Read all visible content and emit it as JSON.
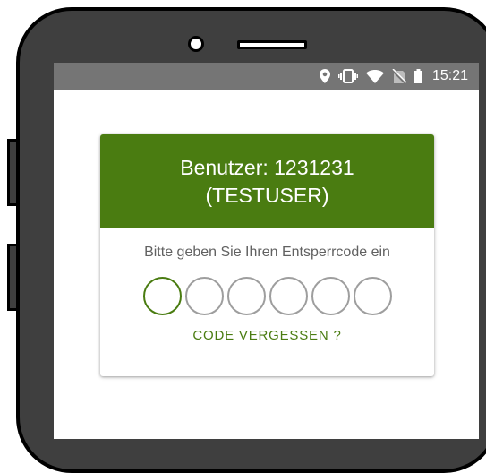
{
  "status_bar": {
    "time": "15:21",
    "icons": [
      "location-icon",
      "vibrate-icon",
      "wifi-icon",
      "no-sim-icon",
      "battery-icon"
    ]
  },
  "login_card": {
    "user_line": "Benutzer: 1231231",
    "user_name": "(TESTUSER)",
    "prompt": "Bitte geben Sie Ihren Entsperrcode ein",
    "pin_length": 6,
    "pin_entered": 0,
    "forgot_label": "CODE VERGESSEN ?"
  },
  "colors": {
    "accent": "#4a7c11",
    "statusbar": "#757575",
    "pin_inactive": "#9e9e9e",
    "device_body": "#3f3f3f"
  }
}
